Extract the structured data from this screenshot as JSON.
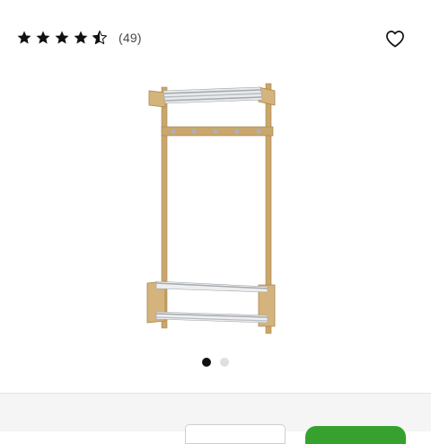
{
  "rating": {
    "value": 4.5,
    "max": 5,
    "review_count_text": "(49)"
  },
  "icons": {
    "star_filled": "star-icon",
    "star_half": "star-half-icon",
    "favorite": "heart-icon"
  },
  "carousel": {
    "total": 2,
    "active_index": 0
  },
  "colors": {
    "star": "#111111",
    "dot_active": "#111111",
    "dot_inactive": "#dfdfdf",
    "primary_button": "#36a12f",
    "wood": "#c9a66b",
    "metal": "#b9bcc0"
  }
}
